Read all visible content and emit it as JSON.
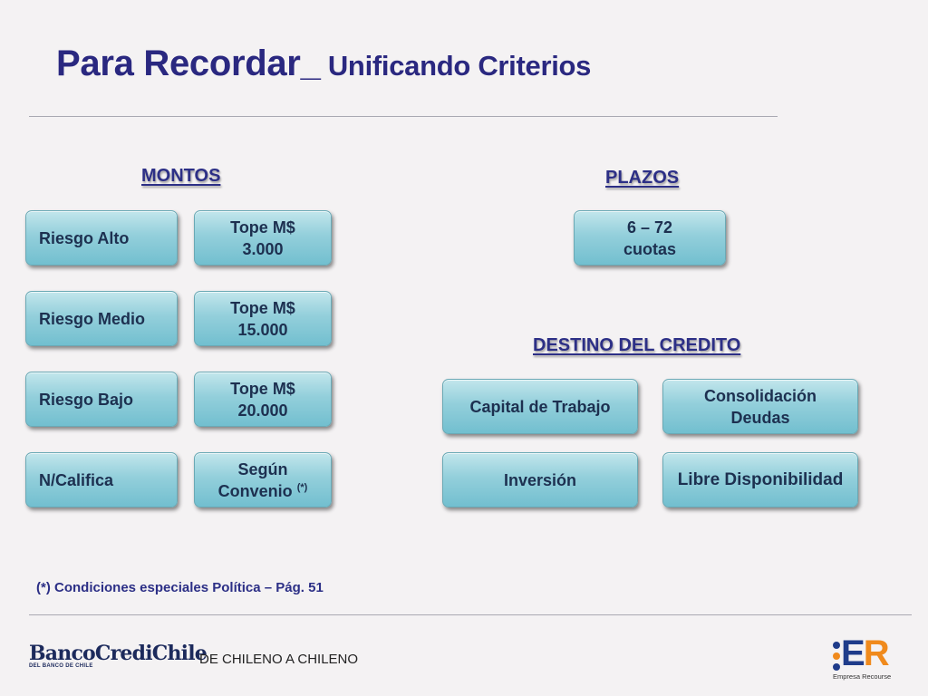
{
  "title": {
    "main": "Para Recordar_",
    "sub": " Unificando Criterios"
  },
  "montos": {
    "heading": "MONTOS",
    "rows": [
      {
        "label": "Riesgo Alto",
        "tope_line1": "Tope M$",
        "tope_line2": "3.000"
      },
      {
        "label": "Riesgo Medio",
        "tope_line1": "Tope M$",
        "tope_line2": "15.000"
      },
      {
        "label": "Riesgo Bajo",
        "tope_line1": "Tope M$",
        "tope_line2": "20.000"
      },
      {
        "label": "N/Califica",
        "tope_line1": "Según",
        "tope_line2": "Convenio",
        "tope_note": "(*)"
      }
    ]
  },
  "plazos": {
    "heading": "PLAZOS",
    "line1": "6 – 72",
    "line2": "cuotas"
  },
  "destino": {
    "heading": "DESTINO DEL CREDITO",
    "items": [
      "Capital de Trabajo",
      "Consolidación Deudas",
      "Inversión",
      "Libre Disponibilidad"
    ]
  },
  "note": "(*) Condiciones especiales Política – Pág. 51",
  "footer": {
    "bank_name": "BancoCrediChile",
    "bank_sub": "DEL BANCO DE CHILE",
    "slogan": "DE CHILENO A CHILENO",
    "er_logo": {
      "letter_e": "E",
      "letter_r": "R",
      "caption": "Empresa Recourse"
    }
  },
  "colors": {
    "title": "#2a2880",
    "box_top": "#c2e6ec",
    "box_bottom": "#72bfcf",
    "er_orange": "#f08a1c",
    "er_blue": "#1f3c8a"
  }
}
